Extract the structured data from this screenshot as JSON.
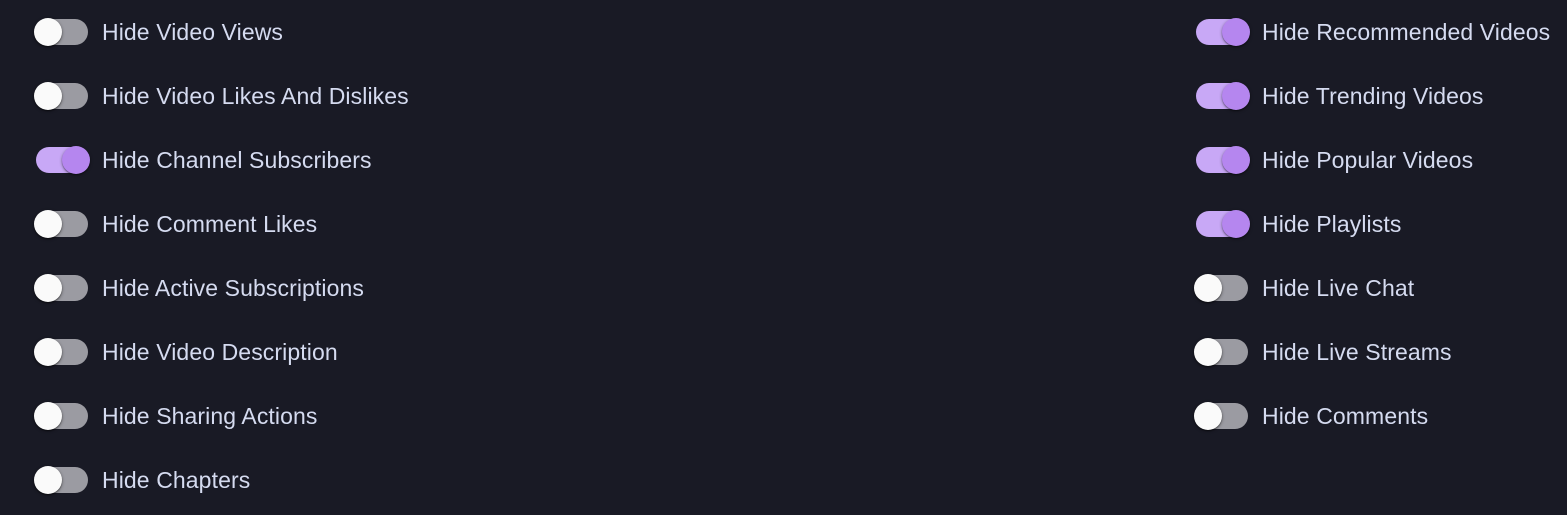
{
  "theme": {
    "background": "#191a25",
    "label_color": "#d5dbf0",
    "track_off_color": "#9b9ba2",
    "knob_off_color": "#fafafa",
    "track_on_color": "#c8a8f6",
    "knob_on_color": "#b586ef"
  },
  "panel": {
    "columns": [
      {
        "id": "left-column",
        "items": [
          {
            "label": "Hide Video Views",
            "state": "off",
            "icon": "toggle-switch-icon"
          },
          {
            "label": "Hide Video Likes And Dislikes",
            "state": "off",
            "icon": "toggle-switch-icon"
          },
          {
            "label": "Hide Channel Subscribers",
            "state": "on",
            "icon": "toggle-switch-icon"
          },
          {
            "label": "Hide Comment Likes",
            "state": "off",
            "icon": "toggle-switch-icon"
          },
          {
            "label": "Hide Active Subscriptions",
            "state": "off",
            "icon": "toggle-switch-icon"
          },
          {
            "label": "Hide Video Description",
            "state": "off",
            "icon": "toggle-switch-icon"
          },
          {
            "label": "Hide Sharing Actions",
            "state": "off",
            "icon": "toggle-switch-icon"
          },
          {
            "label": "Hide Chapters",
            "state": "off",
            "icon": "toggle-switch-icon"
          }
        ]
      },
      {
        "id": "right-column",
        "items": [
          {
            "label": "Hide Recommended Videos",
            "state": "on",
            "icon": "toggle-switch-icon"
          },
          {
            "label": "Hide Trending Videos",
            "state": "on",
            "icon": "toggle-switch-icon"
          },
          {
            "label": "Hide Popular Videos",
            "state": "on",
            "icon": "toggle-switch-icon"
          },
          {
            "label": "Hide Playlists",
            "state": "on",
            "icon": "toggle-switch-icon"
          },
          {
            "label": "Hide Live Chat",
            "state": "off",
            "icon": "toggle-switch-icon"
          },
          {
            "label": "Hide Live Streams",
            "state": "off",
            "icon": "toggle-switch-icon"
          },
          {
            "label": "Hide Comments",
            "state": "off",
            "icon": "toggle-switch-icon"
          }
        ]
      }
    ]
  }
}
